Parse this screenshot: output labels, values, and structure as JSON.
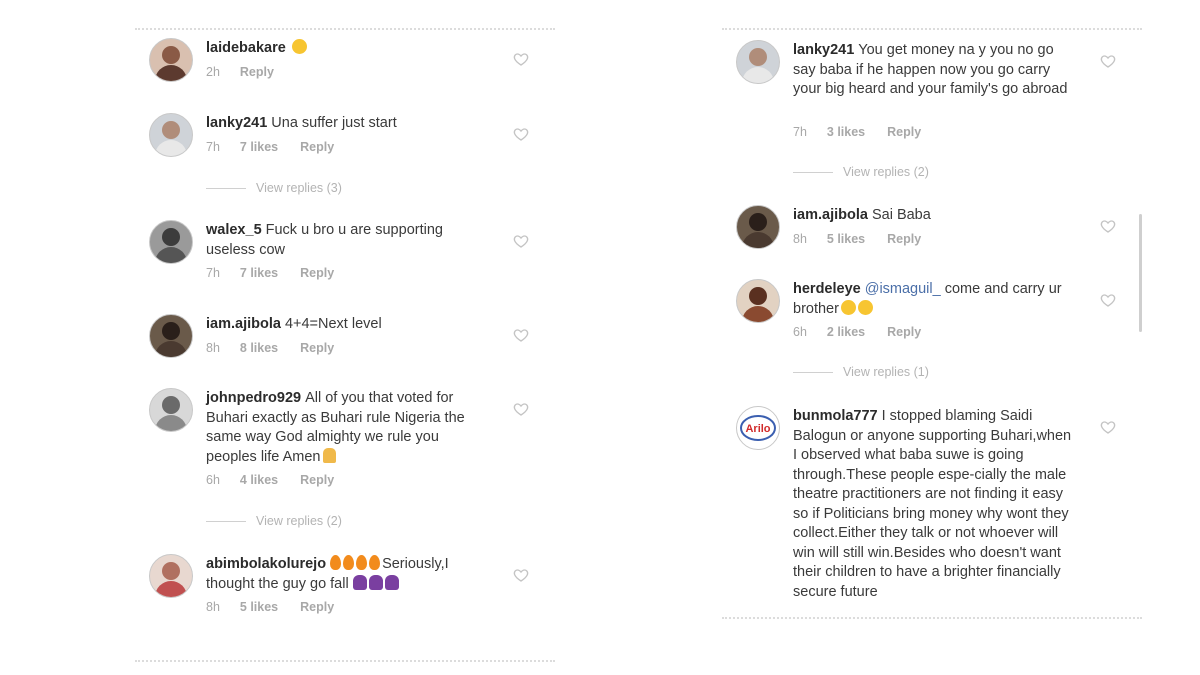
{
  "left_panel": {
    "comments": [
      {
        "username": "laidebakare",
        "text": "",
        "emoji": "laugh",
        "time": "2h",
        "likes": "",
        "reply": "Reply",
        "view_replies": ""
      },
      {
        "username": "lanky241",
        "text": "Una suffer just start",
        "emoji": "",
        "time": "7h",
        "likes": "7 likes",
        "reply": "Reply",
        "view_replies": "View replies (3)"
      },
      {
        "username": "walex_5",
        "text": "Fuck u bro u are supporting useless cow",
        "emoji": "",
        "time": "7h",
        "likes": "7 likes",
        "reply": "Reply",
        "view_replies": ""
      },
      {
        "username": "iam.ajibola",
        "text": "4+4=Next level",
        "emoji": "",
        "time": "8h",
        "likes": "8 likes",
        "reply": "Reply",
        "view_replies": ""
      },
      {
        "username": "johnpedro929",
        "text": "All of you that voted for Buhari exactly as Buhari rule Nigeria the same way God almighty we rule you peoples life Amen",
        "emoji": "pray",
        "time": "6h",
        "likes": "4 likes",
        "reply": "Reply",
        "view_replies": "View replies (2)"
      },
      {
        "username": "abimbolakolurejo",
        "text_after_fire": "Seriously,I thought the guy go fall",
        "emoji": "fire-woman",
        "time": "8h",
        "likes": "5 likes",
        "reply": "Reply",
        "view_replies": ""
      }
    ]
  },
  "right_panel": {
    "comments": [
      {
        "username": "lanky241",
        "text": "You get money na y you no go say baba if he happen now you go carry your big heard and your family's go abroad",
        "time": "7h",
        "likes": "3 likes",
        "reply": "Reply",
        "view_replies": "View replies (2)"
      },
      {
        "username": "iam.ajibola",
        "text": "Sai Baba",
        "time": "8h",
        "likes": "5 likes",
        "reply": "Reply",
        "view_replies": ""
      },
      {
        "username": "herdeleye",
        "mention": "@ismaguil_",
        "text": "come and carry ur brother",
        "emoji": "laugh",
        "time": "6h",
        "likes": "2 likes",
        "reply": "Reply",
        "view_replies": "View replies (1)"
      },
      {
        "username": "bunmola777",
        "text": "I stopped blaming Saidi Balogun or anyone supporting Buhari,when I observed what baba suwe is going through.These people espe-cially the male theatre practitioners are not finding it easy so if Politicians bring money why wont they collect.Either they talk or not whoever will win will still win.Besides who doesn't want their children to have a brighter financially secure future",
        "avatar_label": "Arilo",
        "time": "",
        "likes": "",
        "reply": "",
        "view_replies": ""
      }
    ]
  },
  "colors": {
    "username": "#2b2b2b",
    "meta": "#a8a8a8",
    "mention": "#4b6fa8",
    "heart": "#c4c4c4"
  }
}
